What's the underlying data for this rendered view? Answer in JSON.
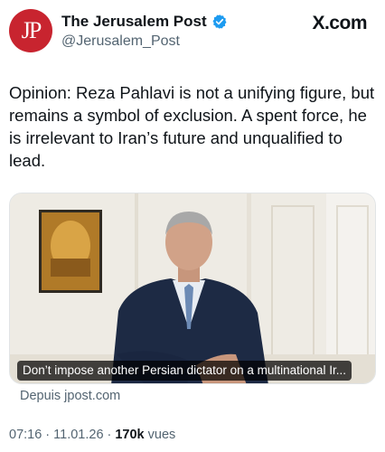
{
  "header": {
    "avatar_text": "JP",
    "display_name": "The Jerusalem Post",
    "handle": "@Jerusalem_Post",
    "verified_icon": "verified-badge-icon",
    "site_brand": "X.com"
  },
  "tweet": {
    "text": "Opinion: Reza Pahlavi is not a unifying figure, but remains a symbol of exclusion. A spent force, he is irrelevant to Iran’s future and unqualified to lead."
  },
  "link_card": {
    "caption": "Don’t impose another Persian dictator on a multinational Ir...",
    "source": "Depuis jpost.com"
  },
  "meta": {
    "time": "07:16",
    "sep1": "·",
    "date": "11.01.26",
    "sep2": "·",
    "views_count": "170k",
    "views_label": "vues"
  },
  "colors": {
    "avatar_bg": "#c8242f",
    "verified_blue": "#1d9bf0",
    "secondary_text": "#536471",
    "primary_text": "#0f1419"
  }
}
